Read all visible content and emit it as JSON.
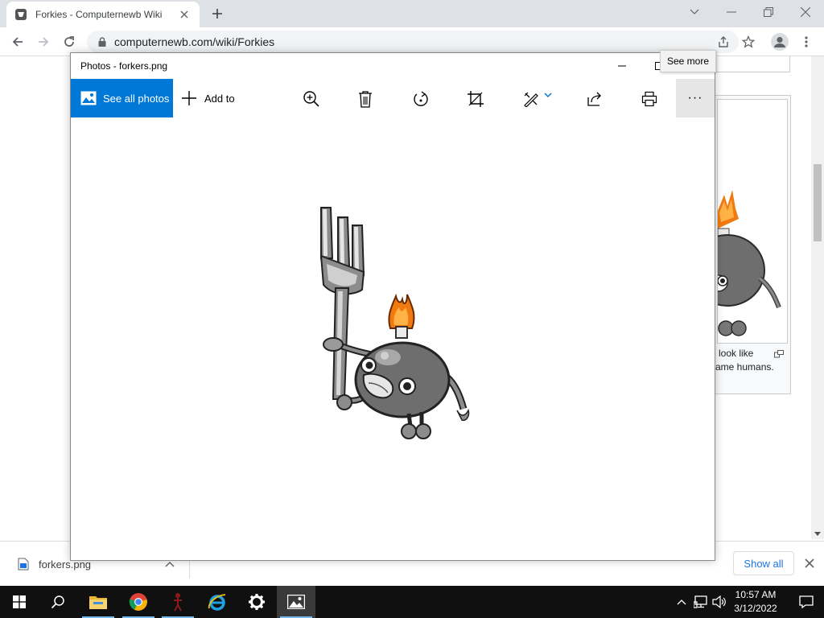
{
  "browser": {
    "tab_title": "Forkies - Computernewb Wiki",
    "url": "computernewb.com/wiki/Forkies"
  },
  "wiki": {
    "caption_line1": "look like",
    "caption_line2": "ame humans."
  },
  "photos": {
    "window_title": "Photos - forkers.png",
    "see_all_label": "See all photos",
    "add_to_label": "Add to",
    "more_label": "···",
    "tooltip": "See more"
  },
  "downloads": {
    "file_name": "forkers.png",
    "show_all_label": "Show all"
  },
  "taskbar": {
    "time": "10:57 AM",
    "date": "3/12/2022"
  },
  "colors": {
    "accent": "#0078d7",
    "chrome_tabstrip": "#dee1e6",
    "taskbar": "#101010",
    "flame": "#f07a10",
    "bomb": "#6e6e6e"
  }
}
